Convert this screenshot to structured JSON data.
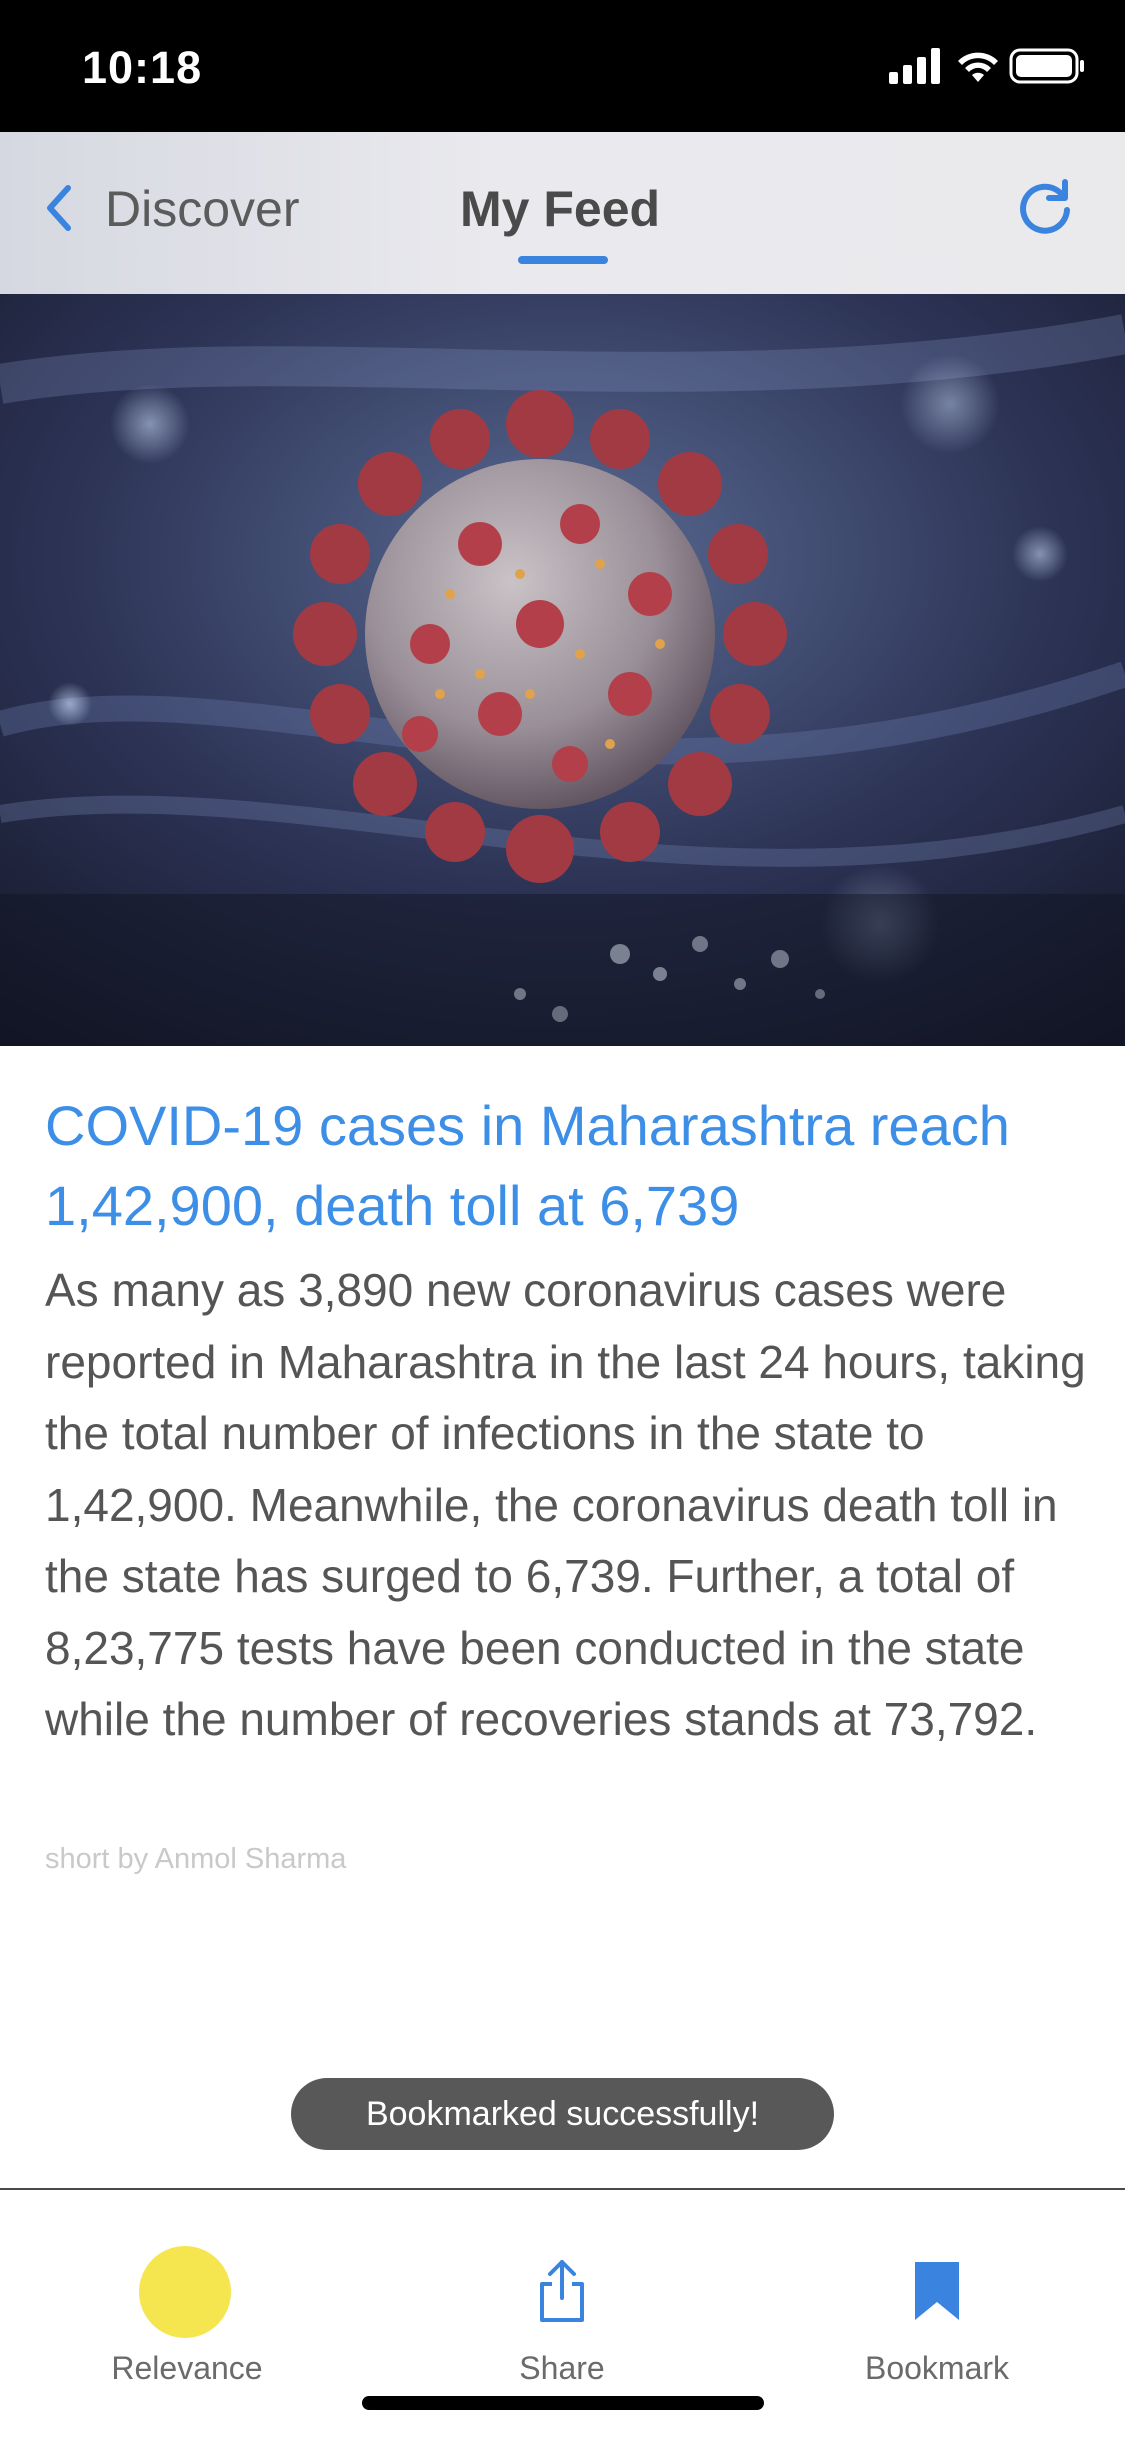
{
  "status_bar": {
    "time": "10:18",
    "icons": [
      "cellular-signal-icon",
      "wifi-icon",
      "battery-icon"
    ]
  },
  "nav": {
    "back_label": "Discover",
    "active_tab": "My Feed",
    "accent_color": "#3a84e0",
    "icons": [
      "chevron-left-icon",
      "refresh-icon"
    ]
  },
  "article": {
    "image": "coronavirus-illustration",
    "headline": "COVID-19 cases in Maharashtra reach 1,42,900, death toll at 6,739",
    "body": "As many as 3,890 new coronavirus cases were reported in Maharashtra in the last 24 hours, taking the total number of infections in the state to 1,42,900. Meanwhile, the coronavirus death toll in the state has surged to 6,739. Further, a total of 8,23,775 tests have been conducted in the state while the number of recoveries stands at 73,792.",
    "byline": "short by Anmol Sharma",
    "headline_color": "#3d8ee6"
  },
  "toast": {
    "message": "Bookmarked successfully!"
  },
  "bottom_bar": {
    "relevance_label": "Relevance",
    "share_label": "Share",
    "bookmark_label": "Bookmark",
    "relevance_color": "#f5e64f"
  }
}
